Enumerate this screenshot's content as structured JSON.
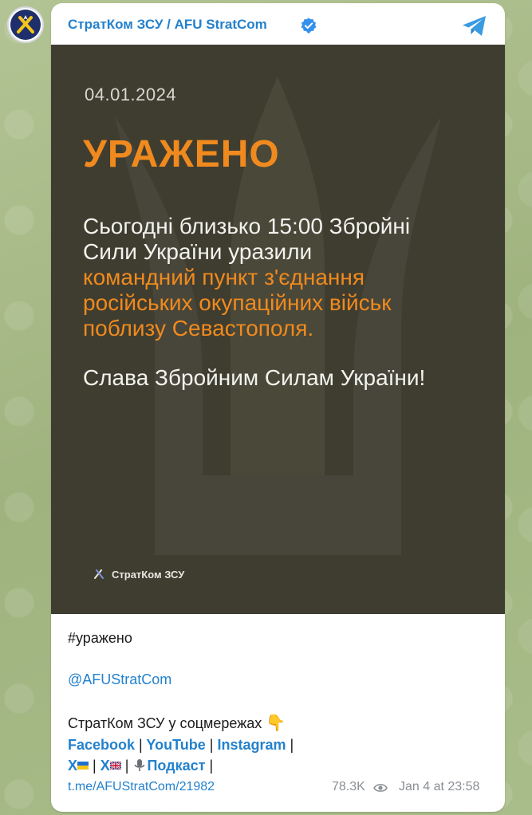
{
  "channel": {
    "name": "СтратКом ЗСУ / AFU StratCom",
    "verified": true,
    "avatar_icon": "afu-stratcom-emblem-icon",
    "platform_icon": "telegram-icon"
  },
  "media": {
    "date": "04.01.2024",
    "headline": "УРАЖЕНО",
    "body_line1": "Сьогодні близько 15:00 Збройні",
    "body_line2": "Сили України уразили",
    "body_highlight1": "командний пункт з'єднання",
    "body_highlight2": "російських окупаційних військ",
    "body_highlight3": "поблизу Севастополя.",
    "glory": "Слава Збройним Силам України!",
    "logo_text": "СтратКом ЗСУ",
    "background_color": "#3f3d30",
    "accent_color": "#f08a1e"
  },
  "caption": {
    "hashtag": "#уражено",
    "mention": "@AFUStratCom",
    "socials_title": "СтратКом ЗСУ у соцмережах",
    "socials_emoji": "👇",
    "links": {
      "facebook": "Facebook",
      "youtube": "YouTube",
      "instagram": "Instagram",
      "x_ua": "X",
      "x_gb": "X",
      "podcast": "Подкаст"
    },
    "separator": "|"
  },
  "footer": {
    "post_link": "t.me/AFUStratCom/21982",
    "views": "78.3K",
    "time": "Jan 4 at 23:58"
  },
  "colors": {
    "link": "#2481cc",
    "meta": "#8a8f95",
    "wallpaper": "#a7b98a"
  }
}
